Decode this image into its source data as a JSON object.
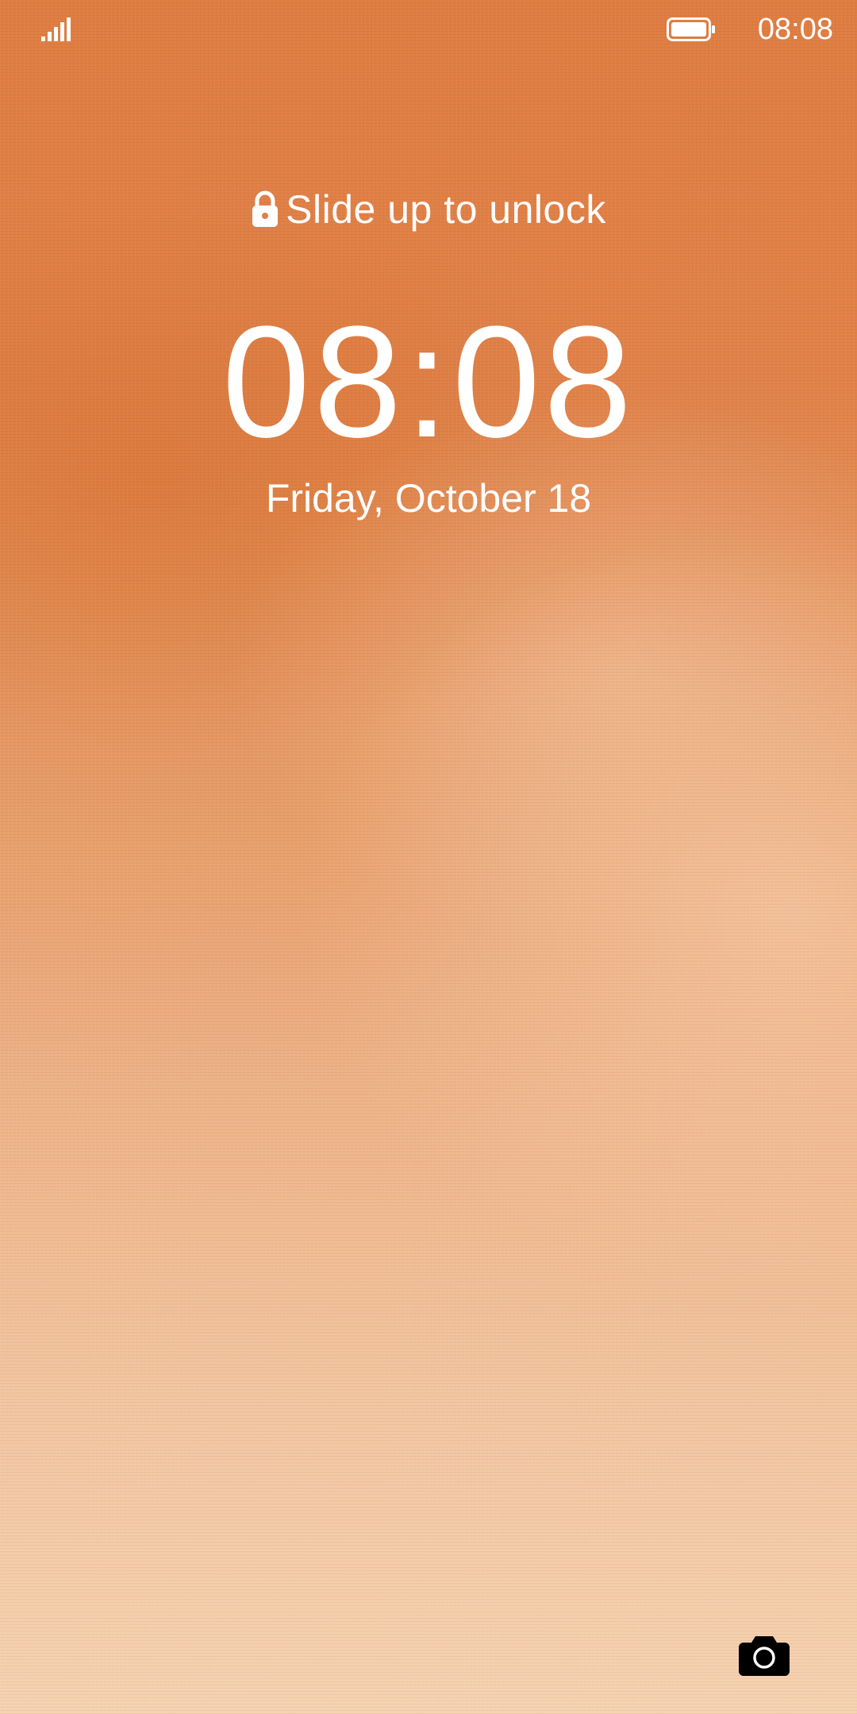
{
  "status_bar": {
    "time": "08:08",
    "signal_icon": "signal-icon",
    "battery_icon": "battery-icon"
  },
  "lockscreen": {
    "unlock_hint": "Slide up to unlock",
    "lock_icon": "lock-icon",
    "clock": "08:08",
    "date": "Friday, October 18",
    "camera_icon": "camera-icon"
  },
  "colors": {
    "wallpaper_top": "#df7d41",
    "wallpaper_bottom": "#f5d2b2",
    "text": "#ffffff",
    "camera": "#000000"
  }
}
